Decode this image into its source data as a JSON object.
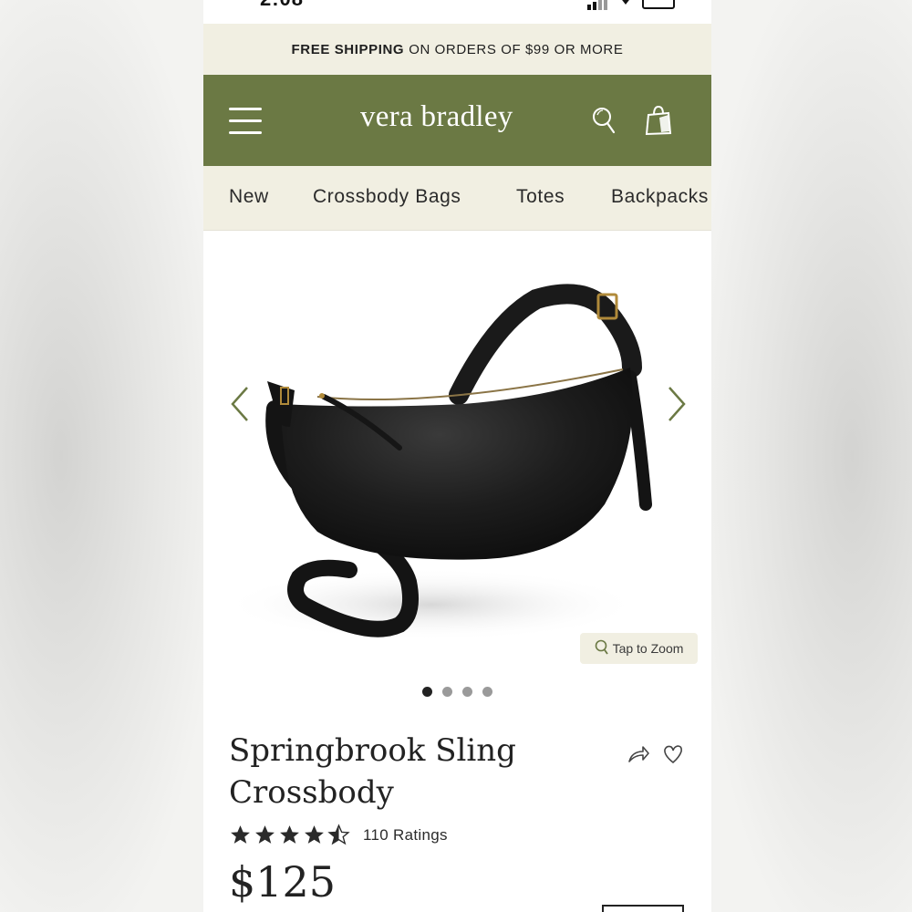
{
  "status_bar": {
    "time": "2:08"
  },
  "promo": {
    "bold": "FREE SHIPPING",
    "rest": "ON ORDERS OF $99 OR MORE"
  },
  "header": {
    "logo": "vera bradley",
    "brand_color": "#6b7944"
  },
  "nav": {
    "items": [
      "New",
      "Crossbody Bags",
      "Totes",
      "Backpacks"
    ]
  },
  "gallery": {
    "zoom_label": "Tap to Zoom",
    "image_count": 4,
    "active_index": 0
  },
  "product": {
    "title_line1": "Springbrook Sling",
    "title_line2": "Crossbody",
    "rating": 4.5,
    "rating_text": "110 Ratings",
    "price": "$125"
  },
  "icons": [
    "menu-icon",
    "search-icon",
    "shopping-bag-icon",
    "chevron-left-icon",
    "chevron-right-icon",
    "zoom-icon",
    "share-icon",
    "heart-icon",
    "star-icon"
  ]
}
